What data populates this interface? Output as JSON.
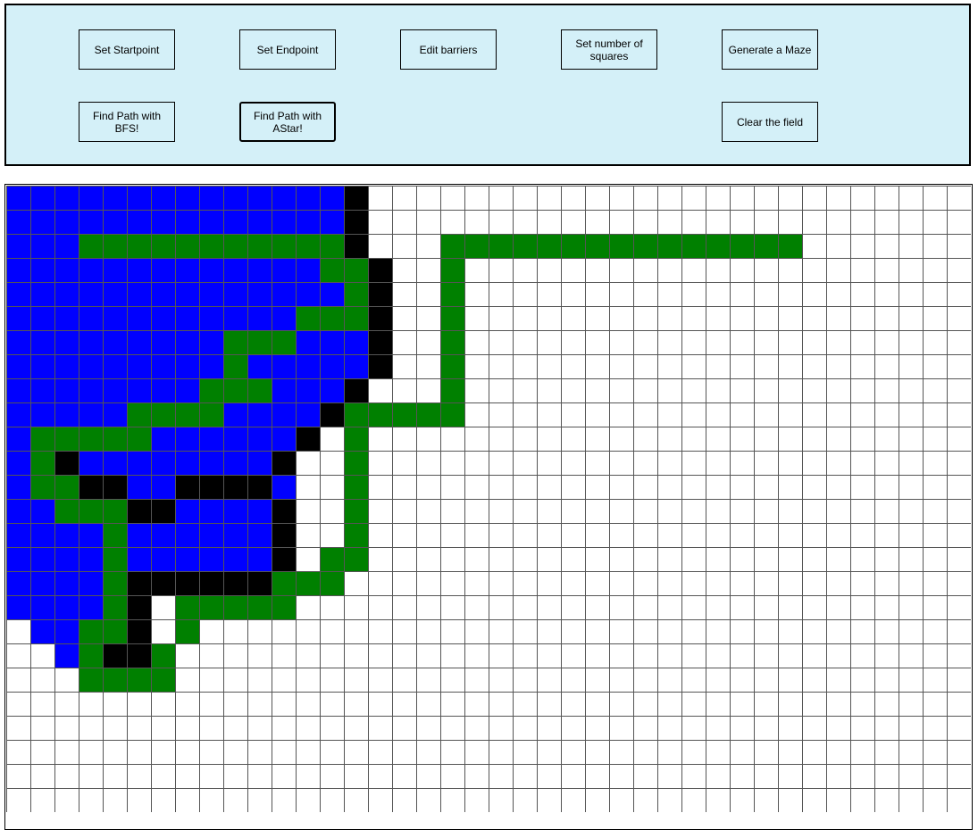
{
  "toolbar": {
    "set_start_label": "Set Startpoint",
    "set_end_label": "Set Endpoint",
    "edit_barriers_label": "Edit barriers",
    "set_squares_label": "Set number of squares",
    "generate_maze_label": "Generate a Maze",
    "find_bfs_label": "Find Path with BFS!",
    "find_astar_label": "Find Path with AStar!",
    "clear_label": "Clear the field"
  },
  "colors": {
    "panel_bg": "#d4f0f8",
    "visited": "#0000ff",
    "path": "#008000",
    "barrier": "#000000",
    "empty": "#ffffff",
    "grid_line": "#555555"
  },
  "grid": {
    "columns": 40,
    "rows": 26,
    "cells": [
      "BBBBBBBBBBBBBBX.........................",
      "BBBBBBBBBBBBBBX.........................",
      "BBBGGGGGGGGGGGX...GGGGGGGGGGGGGGG.......",
      "BBBBBBBBBBBBBGGX..G.....................",
      "BBBBBBBBBBBBBBGX..G.....................",
      "BBBBBBBBBBBBGGGX..G.....................",
      "BBBBBBBBBGGGBBBX..G.....................",
      "BBBBBBBBBGBBBBBX..G.....................",
      "BBBBBBBBGGGBBBX...G.....................",
      "BBBBBGGGGBBBBXGGGGG.....................",
      "BGGGGGBBBBBBX.G.........................",
      "BGXBBBBBBBBX..G.........................",
      "BGGXXBBXXXXB..G.........................",
      "BBGGGXXBBBBX..G.........................",
      "BBBBGBBBBBBX..G.........................",
      "BBBBGBBBBBBX.GG.........................",
      "BBBBGXXXXXXGGG..........................",
      "BBBBGX.GGGGG............................",
      ".BBGGX.G................................",
      "..BGXXG.................................",
      "...GGGG.................................",
      "........................................",
      "........................................",
      "........................................",
      "........................................",
      "........................................",
      "........................................"
    ]
  }
}
